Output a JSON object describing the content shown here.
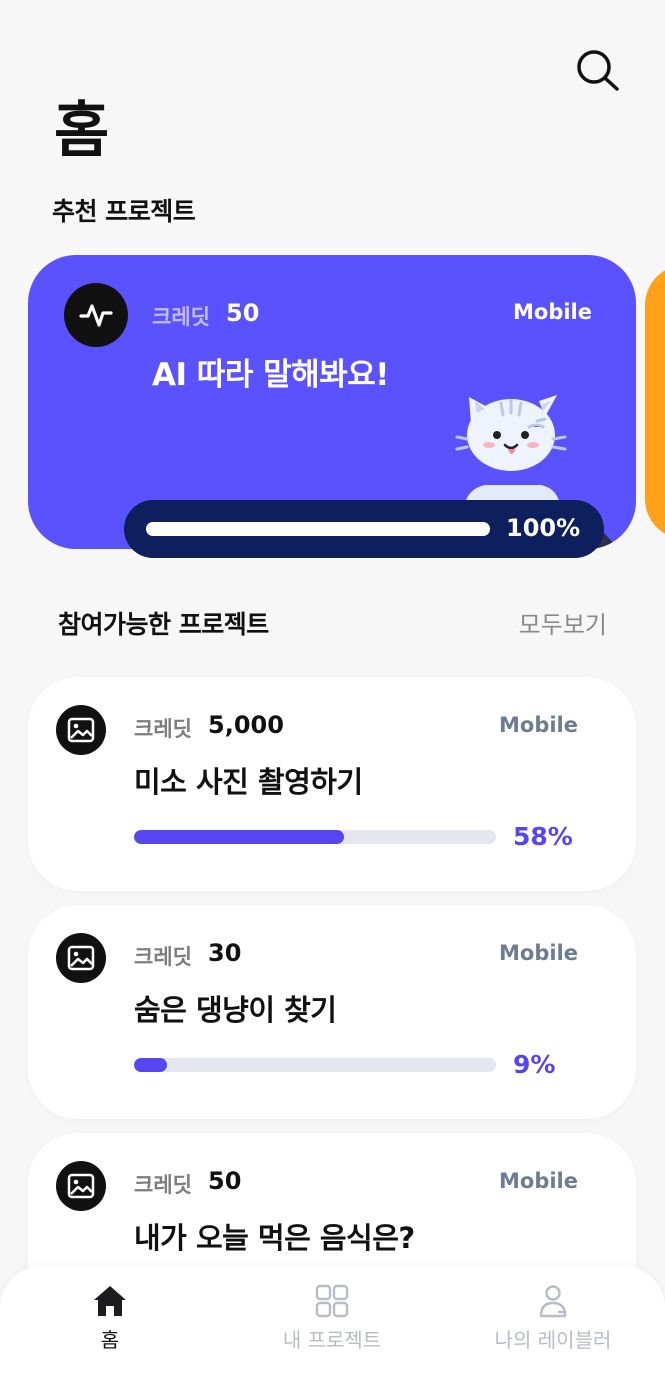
{
  "header": {
    "title": "홈",
    "search_icon": "search-icon"
  },
  "recommended": {
    "section_title": "추천 프로젝트",
    "featured": {
      "icon": "activity-icon",
      "credit_label": "크레딧",
      "credit_value": "50",
      "platform": "Mobile",
      "title": "AI 따라 말해봐요!",
      "progress": 1.0,
      "progress_text": "100%",
      "color": "#5b52ff"
    },
    "next_card_color": "#ffa21a"
  },
  "available": {
    "section_title": "참여가능한 프로젝트",
    "see_all": "모두보기",
    "projects": [
      {
        "icon": "image-icon",
        "credit_label": "크레딧",
        "credit_value": "5,000",
        "platform": "Mobile",
        "title": "미소 사진 촬영하기",
        "progress": 0.58,
        "progress_text": "58%"
      },
      {
        "icon": "image-icon",
        "credit_label": "크레딧",
        "credit_value": "30",
        "platform": "Mobile",
        "title": "숨은 댕냥이 찾기",
        "progress": 0.09,
        "progress_text": "9%"
      },
      {
        "icon": "image-icon",
        "credit_label": "크레딧",
        "credit_value": "50",
        "platform": "Mobile",
        "title": "내가 오늘 먹은 음식은?"
      }
    ]
  },
  "bottom_nav": {
    "items": [
      {
        "label": "홈",
        "icon": "home-icon",
        "active": true
      },
      {
        "label": "내 프로젝트",
        "icon": "grid-icon",
        "active": false
      },
      {
        "label": "나의 레이블러",
        "icon": "user-icon",
        "active": false
      }
    ]
  },
  "colors": {
    "accent": "#5546f2",
    "featured_bg": "#5b52ff",
    "progress_dark": "#0d1f5c",
    "platform_text": "#6e7c92"
  }
}
